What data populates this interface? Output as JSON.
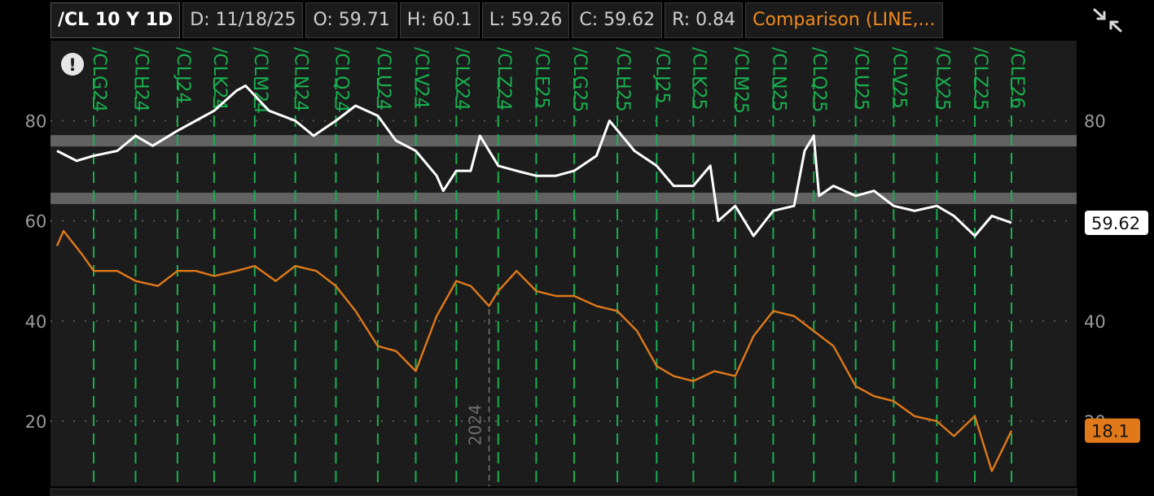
{
  "header": {
    "symbol": "/CL 10 Y 1D",
    "date": "D: 11/18/25",
    "open": "O: 59.71",
    "high": "H: 60.1",
    "low": "L: 59.26",
    "close": "C: 59.62",
    "range": "R: 0.84",
    "comparison": "Comparison (LINE,..."
  },
  "alert_glyph": "!",
  "chart_data": {
    "type": "line",
    "y_axis": {
      "ticks": [
        20,
        40,
        60,
        80
      ],
      "range": [
        7,
        96
      ]
    },
    "x_range": [
      "2023-11-20",
      "2025-11-18"
    ],
    "horizontal_bands": [
      76,
      64.5
    ],
    "year_marker": {
      "label": "2024",
      "date": "2024-10-15"
    },
    "contract_rolls": [
      {
        "label": "/CLG24",
        "date": "2023-12-18"
      },
      {
        "label": "/CLH24",
        "date": "2024-01-19"
      },
      {
        "label": "/CLJ24",
        "date": "2024-02-20"
      },
      {
        "label": "/CLK24",
        "date": "2024-03-19"
      },
      {
        "label": "/CLM24",
        "date": "2024-04-19"
      },
      {
        "label": "/CLN24",
        "date": "2024-05-20"
      },
      {
        "label": "/CLQ24",
        "date": "2024-06-20"
      },
      {
        "label": "/CLU24",
        "date": "2024-07-22"
      },
      {
        "label": "/CLV24",
        "date": "2024-08-20"
      },
      {
        "label": "/CLX24",
        "date": "2024-09-20"
      },
      {
        "label": "/CLZ24",
        "date": "2024-10-22"
      },
      {
        "label": "/CLF25",
        "date": "2024-11-20"
      },
      {
        "label": "/CLG25",
        "date": "2024-12-19"
      },
      {
        "label": "/CLH25",
        "date": "2025-01-21"
      },
      {
        "label": "/CLJ25",
        "date": "2025-02-20"
      },
      {
        "label": "/CLK25",
        "date": "2025-03-20"
      },
      {
        "label": "/CLM25",
        "date": "2025-04-21"
      },
      {
        "label": "/CLN25",
        "date": "2025-05-20"
      },
      {
        "label": "/CLQ25",
        "date": "2025-06-20"
      },
      {
        "label": "/CLU25",
        "date": "2025-07-22"
      },
      {
        "label": "/CLV25",
        "date": "2025-08-20"
      },
      {
        "label": "/CLX25",
        "date": "2025-09-22"
      },
      {
        "label": "/CLZ25",
        "date": "2025-10-21"
      },
      {
        "label": "/CLF26",
        "date": "2025-11-18"
      }
    ],
    "series": [
      {
        "color": "#ffffff",
        "last_value": "59.62",
        "points": [
          [
            "2023-11-20",
            74
          ],
          [
            "2023-12-05",
            72
          ],
          [
            "2023-12-18",
            73
          ],
          [
            "2024-01-05",
            74
          ],
          [
            "2024-01-19",
            77
          ],
          [
            "2024-02-01",
            75
          ],
          [
            "2024-02-20",
            78
          ],
          [
            "2024-03-05",
            80
          ],
          [
            "2024-03-19",
            82
          ],
          [
            "2024-04-05",
            86
          ],
          [
            "2024-04-12",
            87
          ],
          [
            "2024-04-30",
            82
          ],
          [
            "2024-05-20",
            80
          ],
          [
            "2024-06-03",
            77
          ],
          [
            "2024-06-20",
            80
          ],
          [
            "2024-07-05",
            83
          ],
          [
            "2024-07-22",
            81
          ],
          [
            "2024-08-05",
            76
          ],
          [
            "2024-08-20",
            74
          ],
          [
            "2024-09-05",
            69
          ],
          [
            "2024-09-10",
            66
          ],
          [
            "2024-09-20",
            70
          ],
          [
            "2024-10-01",
            70
          ],
          [
            "2024-10-08",
            77
          ],
          [
            "2024-10-22",
            71
          ],
          [
            "2024-11-05",
            70
          ],
          [
            "2024-11-20",
            69
          ],
          [
            "2024-12-05",
            69
          ],
          [
            "2024-12-19",
            70
          ],
          [
            "2025-01-05",
            73
          ],
          [
            "2025-01-15",
            80
          ],
          [
            "2025-02-03",
            74
          ],
          [
            "2025-02-20",
            71
          ],
          [
            "2025-03-05",
            67
          ],
          [
            "2025-03-20",
            67
          ],
          [
            "2025-04-02",
            71
          ],
          [
            "2025-04-08",
            60
          ],
          [
            "2025-04-21",
            63
          ],
          [
            "2025-05-05",
            57
          ],
          [
            "2025-05-20",
            62
          ],
          [
            "2025-06-05",
            63
          ],
          [
            "2025-06-13",
            74
          ],
          [
            "2025-06-20",
            77
          ],
          [
            "2025-06-24",
            65
          ],
          [
            "2025-07-05",
            67
          ],
          [
            "2025-07-22",
            65
          ],
          [
            "2025-08-05",
            66
          ],
          [
            "2025-08-20",
            63
          ],
          [
            "2025-09-05",
            62
          ],
          [
            "2025-09-22",
            63
          ],
          [
            "2025-10-05",
            61
          ],
          [
            "2025-10-21",
            57
          ],
          [
            "2025-11-03",
            61
          ],
          [
            "2025-11-18",
            59.62
          ]
        ]
      },
      {
        "color": "#e0791a",
        "last_value": "18.1",
        "points": [
          [
            "2023-11-20",
            55
          ],
          [
            "2023-11-25",
            58
          ],
          [
            "2023-12-10",
            53
          ],
          [
            "2023-12-18",
            50
          ],
          [
            "2024-01-05",
            50
          ],
          [
            "2024-01-19",
            48
          ],
          [
            "2024-02-05",
            47
          ],
          [
            "2024-02-20",
            50
          ],
          [
            "2024-03-05",
            50
          ],
          [
            "2024-03-19",
            49
          ],
          [
            "2024-04-05",
            50
          ],
          [
            "2024-04-19",
            51
          ],
          [
            "2024-05-05",
            48
          ],
          [
            "2024-05-20",
            51
          ],
          [
            "2024-06-05",
            50
          ],
          [
            "2024-06-20",
            47
          ],
          [
            "2024-07-05",
            42
          ],
          [
            "2024-07-22",
            35
          ],
          [
            "2024-08-05",
            34
          ],
          [
            "2024-08-20",
            30
          ],
          [
            "2024-09-05",
            41
          ],
          [
            "2024-09-20",
            48
          ],
          [
            "2024-10-01",
            47
          ],
          [
            "2024-10-15",
            43
          ],
          [
            "2024-10-22",
            46
          ],
          [
            "2024-11-05",
            50
          ],
          [
            "2024-11-20",
            46
          ],
          [
            "2024-12-05",
            45
          ],
          [
            "2024-12-19",
            45
          ],
          [
            "2025-01-05",
            43
          ],
          [
            "2025-01-21",
            42
          ],
          [
            "2025-02-05",
            38
          ],
          [
            "2025-02-20",
            31
          ],
          [
            "2025-03-05",
            29
          ],
          [
            "2025-03-20",
            28
          ],
          [
            "2025-04-05",
            30
          ],
          [
            "2025-04-21",
            29
          ],
          [
            "2025-05-05",
            37
          ],
          [
            "2025-05-20",
            42
          ],
          [
            "2025-06-05",
            41
          ],
          [
            "2025-06-20",
            38
          ],
          [
            "2025-07-05",
            35
          ],
          [
            "2025-07-22",
            27
          ],
          [
            "2025-08-05",
            25
          ],
          [
            "2025-08-20",
            24
          ],
          [
            "2025-09-05",
            21
          ],
          [
            "2025-09-22",
            20
          ],
          [
            "2025-10-05",
            17
          ],
          [
            "2025-10-21",
            21
          ],
          [
            "2025-11-03",
            10
          ],
          [
            "2025-11-18",
            18.1
          ]
        ]
      }
    ]
  }
}
